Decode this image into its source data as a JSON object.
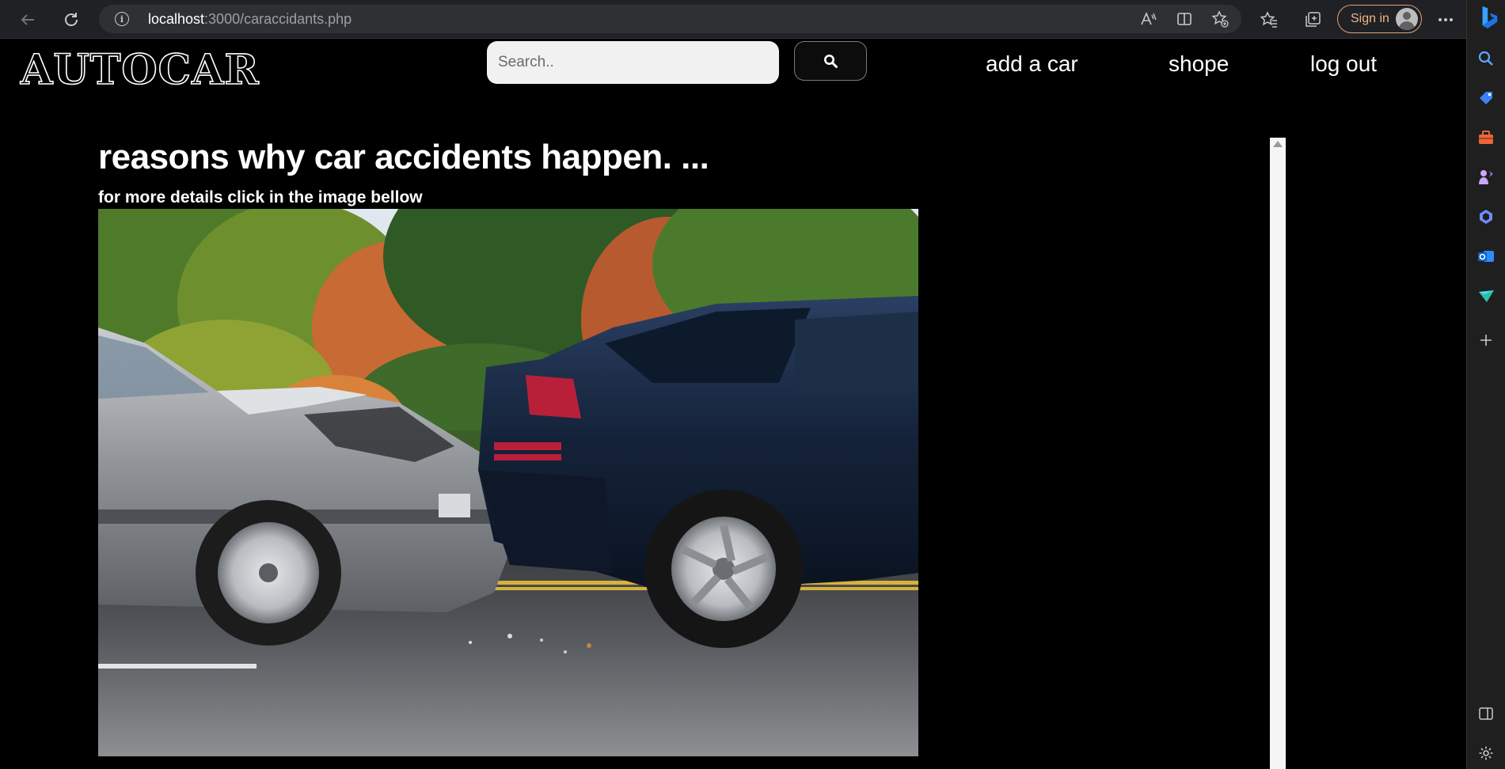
{
  "browser": {
    "url_host": "localhost",
    "url_rest": ":3000/caraccidants.php",
    "signin_label": "Sign in"
  },
  "header": {
    "logo_text": "AUTOCAR",
    "search_placeholder": "Search..",
    "nav": [
      {
        "label": "add a car"
      },
      {
        "label": "shope"
      },
      {
        "label": "log out"
      }
    ]
  },
  "main": {
    "title": "reasons why car accidents happen. ...",
    "subtitle": "for more details click in the image bellow"
  },
  "icons": {
    "back": "back-arrow-icon",
    "reload": "reload-icon",
    "site_info": "info-icon",
    "read_aloud": "read-aloud-icon",
    "split_screen": "split-screen-icon",
    "add_favorite": "add-favorite-icon",
    "favorites": "favorites-icon",
    "collections": "collections-icon",
    "more": "more-icon",
    "search": "search-icon"
  },
  "colors": {
    "page_bg": "#000000",
    "chrome_bg": "#202124",
    "signin_accent": "#f0b48a",
    "text": "#ffffff"
  }
}
